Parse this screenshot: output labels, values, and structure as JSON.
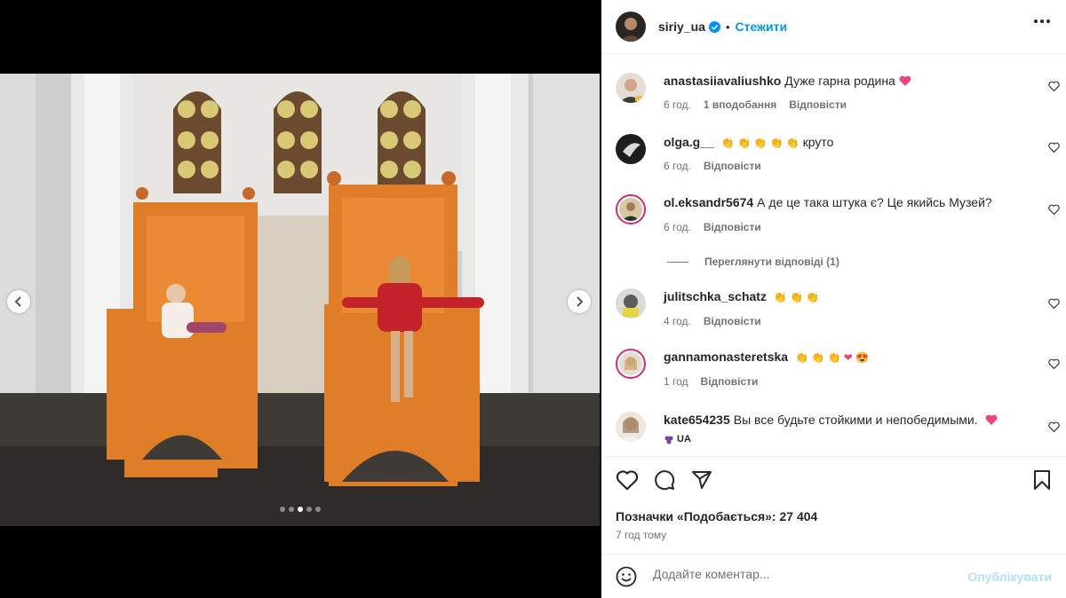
{
  "post": {
    "username": "siriy_ua",
    "separator": "•",
    "follow_label": "Стежити",
    "carousel": {
      "total_slides": 5,
      "active_slide": 3
    }
  },
  "comments": [
    {
      "user": "anastasiiavaliushko",
      "text": "Дуже гарна родина",
      "emoji": "heart",
      "time": "6 год.",
      "likes": "1 вподобання",
      "reply": "Відповісти"
    },
    {
      "user": "olga.g__",
      "text": "круто",
      "emoji": "clap x5",
      "time": "6 год.",
      "reply": "Відповісти"
    },
    {
      "user": "ol.eksandr5674",
      "text": "А де це така штука є? Це якийсь Музей?",
      "time": "6 год.",
      "reply": "Відповісти"
    },
    {
      "user": "julitschka_schatz",
      "text": "",
      "emoji": "clap x3",
      "time": "4 год.",
      "reply": "Відповісти"
    },
    {
      "user": "gannamonasteretska",
      "text": "",
      "emoji": "clap x3, heart, heart-eyes",
      "time": "1 год",
      "reply": "Відповісти"
    },
    {
      "user": "kate654235",
      "text": "Вы все будьте стойкими и непобедимыми.",
      "emoji": "heart",
      "badge": "UA"
    }
  ],
  "view_replies": "Переглянути відповіді (1)",
  "likes_text": "Позначки «Подобається»: 27 404",
  "post_time": "7 год тому",
  "add_comment": {
    "placeholder": "Додайте коментар...",
    "post_label": "Опублікувати"
  },
  "icons": [
    "more-icon",
    "verified-icon",
    "heart-icon",
    "comment-icon",
    "share-icon",
    "bookmark-icon",
    "emoji-icon",
    "chevron-left-icon",
    "chevron-right-icon"
  ],
  "colors": {
    "accent": "#0095f6",
    "post_disabled": "#b2dffc",
    "heart": "#ed4956",
    "ring": "#d62976"
  }
}
